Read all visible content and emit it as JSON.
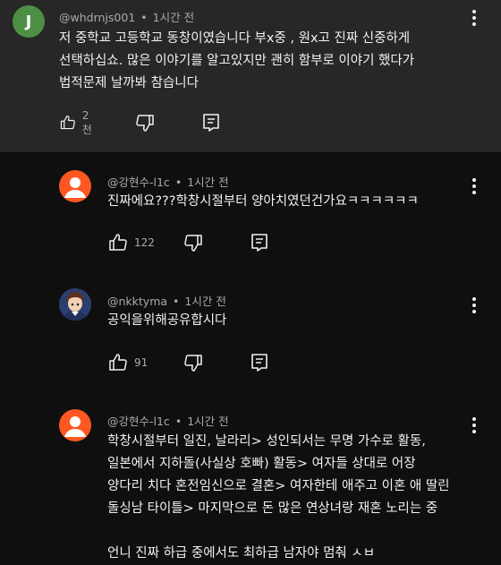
{
  "comments": [
    {
      "avatar_letter": "J",
      "avatar_color": "#4e8f46",
      "author": "@whdrnjs001",
      "time": "1시간 전",
      "lines": [
        "저  중학교 고등학교 동창이였습니다 부x중 , 원x고 진짜 신중하게",
        "선택하십쇼. 많은 이야기를 알고있지만 괜히 함부로 이야기 했다가",
        "법적문제 날까봐 참습니다"
      ],
      "like_count": "2천"
    },
    {
      "avatar_letter": "",
      "avatar_color": "#ff5722",
      "author": "@강현수-l1c",
      "time": "1시간 전",
      "lines": [
        "진짜에요???학창시절부터 양아치였던건가요ㅋㅋㅋㅋㅋㅋ"
      ],
      "like_count": "122"
    },
    {
      "avatar_letter": "",
      "avatar_color": "#3b4a7a",
      "author": "@nkktyma",
      "time": "1시간 전",
      "lines": [
        "공익을위해공유합시다"
      ],
      "like_count": "91"
    },
    {
      "avatar_letter": "",
      "avatar_color": "#ff5722",
      "author": "@강현수-l1c",
      "time": "1시간 전",
      "lines": [
        "학창시절부터 일진, 날라리> 성인되서는 무명 가수로 활동,",
        "일본에서 지하돌(사실상 호빠) 활동> 여자들 상대로 어장",
        "양다리 치다 혼전임신으로 결혼> 여자한테 애주고 이혼 애 딸린",
        "돌싱남 타이틀> 마지막으로 돈 많은 연상녀랑 재혼 노리는 중",
        "",
        "언니 진짜 하급 중에서도 최하급 남자야 멈춰 ㅅㅂ"
      ]
    }
  ],
  "icons": {
    "like": "thumbs-up-icon",
    "dislike": "thumbs-down-icon",
    "reply": "reply-icon",
    "more": "more-vert-icon"
  }
}
